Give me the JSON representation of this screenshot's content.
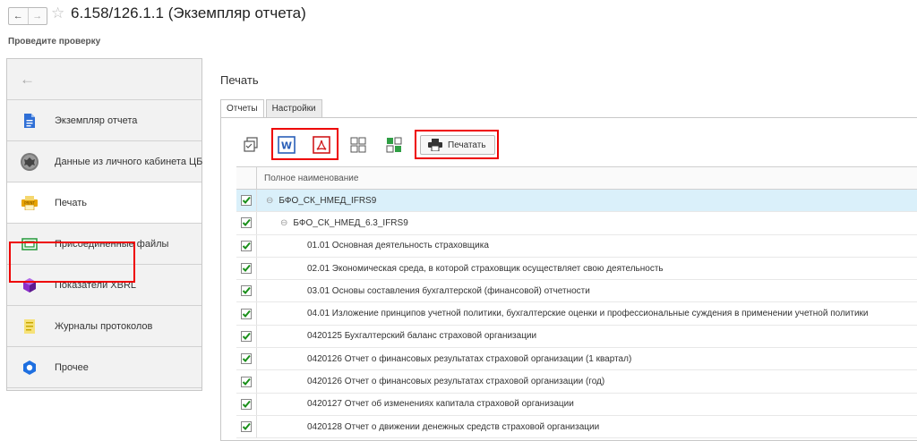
{
  "window": {
    "title": "6.158/126.1.1 (Экземпляр отчета)",
    "subtitle": "Проведите проверку",
    "back_glyph": "←",
    "forward_glyph": "→",
    "favorite_glyph": "☆"
  },
  "sidebar": {
    "back_glyph": "←",
    "items": [
      {
        "label": "Экземпляр отчета",
        "icon": "document-icon"
      },
      {
        "label": "Данные из личного кабинета ЦБ",
        "icon": "bank-emblem-icon"
      },
      {
        "label": "Печать",
        "icon": "print-icon",
        "active": true
      },
      {
        "label": "Присоединенные файлы",
        "icon": "attachment-icon"
      },
      {
        "label": "Показатели XBRL",
        "icon": "cube-icon"
      },
      {
        "label": "Журналы протоколов",
        "icon": "journal-icon"
      },
      {
        "label": "Прочее",
        "icon": "other-icon"
      }
    ]
  },
  "main": {
    "title": "Печать",
    "tabs": [
      {
        "label": "Отчеты",
        "active": true
      },
      {
        "label": "Настройки",
        "active": false
      }
    ],
    "toolbar": {
      "print_label": "Печатать"
    },
    "table": {
      "column_header": "Полное наименование",
      "rows": [
        {
          "text": "БФО_СК_НМЕД_IFRS9",
          "level": 0,
          "group": true,
          "checked": true,
          "selected": true
        },
        {
          "text": "БФО_СК_НМЕД_6.3_IFRS9",
          "level": 1,
          "group": true,
          "checked": true
        },
        {
          "text": "01.01 Основная деятельность страховщика",
          "level": 2,
          "checked": true
        },
        {
          "text": "02.01 Экономическая среда, в которой страховщик осуществляет свою деятельность",
          "level": 2,
          "checked": true
        },
        {
          "text": "03.01 Основы составления бухгалтерской (финансовой) отчетности",
          "level": 2,
          "checked": true
        },
        {
          "text": "04.01 Изложение принципов учетной политики, бухгалтерские оценки и профессиональные суждения в применении учетной политики",
          "level": 2,
          "checked": true
        },
        {
          "text": "0420125 Бухгалтерский баланс страховой организации",
          "level": 2,
          "checked": true
        },
        {
          "text": "0420126 Отчет о финансовых результатах страховой организации (1 квартал)",
          "level": 2,
          "checked": true
        },
        {
          "text": "0420126 Отчет о финансовых результатах страховой организации (год)",
          "level": 2,
          "checked": true
        },
        {
          "text": "0420127 Отчет об изменениях капитала страховой организации",
          "level": 2,
          "checked": true
        },
        {
          "text": "0420128 Отчет о движении денежных средств страховой организации",
          "level": 2,
          "checked": true
        }
      ]
    }
  },
  "colors": {
    "highlight": "#ee0000",
    "check_green": "#1a8f1a",
    "selection": "#daf0fa"
  }
}
